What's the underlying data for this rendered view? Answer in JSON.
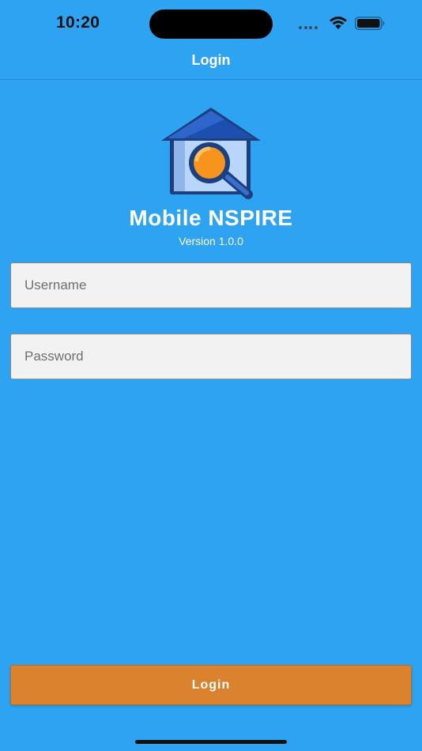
{
  "status_bar": {
    "time": "10:20",
    "signal_icon": "cellular-dots-icon",
    "wifi_icon": "wifi-icon",
    "battery_icon": "battery-icon"
  },
  "nav": {
    "title": "Login"
  },
  "app": {
    "logo_icon": "house-magnifier-logo-icon",
    "name": "Mobile NSPIRE",
    "version": "Version 1.0.0"
  },
  "form": {
    "username_placeholder": "Username",
    "username_value": "",
    "password_placeholder": "Password",
    "password_value": "",
    "login_label": "Login"
  },
  "colors": {
    "background": "#2ea3f2",
    "login_button": "#db822e",
    "field_background": "#f2f2f2",
    "logo_roof": "#1c4aa0",
    "logo_lens": "#f7941d"
  }
}
